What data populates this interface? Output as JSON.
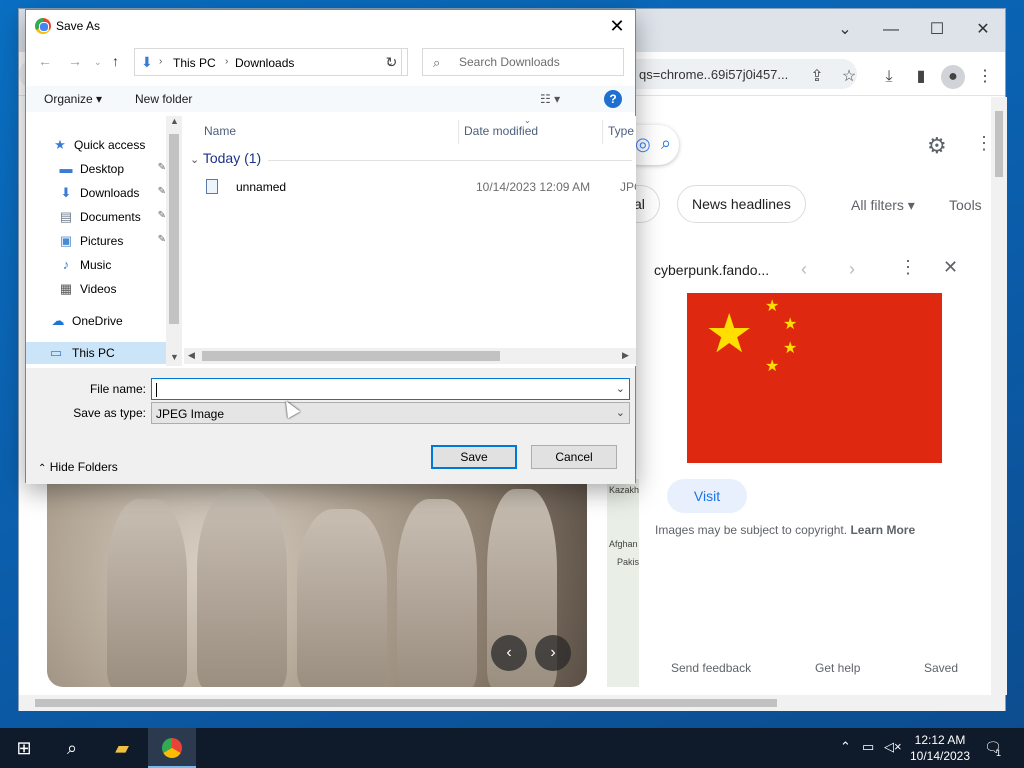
{
  "browser": {
    "url_fragment": "qs=chrome..69i57j0i457...",
    "chips": [
      "ital",
      "News headlines"
    ],
    "all_filters": "All filters",
    "tools": "Tools",
    "panel_source": "cyberpunk.fando...",
    "visit": "Visit",
    "copyright": "Images may be subject to copyright.",
    "learn_more": "Learn More",
    "footer": [
      "Send feedback",
      "Get help",
      "Saved"
    ],
    "map_labels": [
      "Kazakh",
      "Afghan",
      "Pakis"
    ]
  },
  "dialog": {
    "title": "Save As",
    "breadcrumb": [
      "This PC",
      "Downloads"
    ],
    "search_placeholder": "Search Downloads",
    "organize": "Organize",
    "new_folder": "New folder",
    "help": "?",
    "tree": [
      {
        "label": "Quick access",
        "icon": "star-icon"
      },
      {
        "label": "Desktop",
        "icon": "desktop-icon",
        "pinned": true
      },
      {
        "label": "Downloads",
        "icon": "download-icon",
        "pinned": true
      },
      {
        "label": "Documents",
        "icon": "documents-icon",
        "pinned": true
      },
      {
        "label": "Pictures",
        "icon": "pictures-icon",
        "pinned": true
      },
      {
        "label": "Music",
        "icon": "music-icon"
      },
      {
        "label": "Videos",
        "icon": "videos-icon"
      },
      {
        "label": "OneDrive",
        "icon": "cloud-icon"
      },
      {
        "label": "This PC",
        "icon": "computer-icon",
        "selected": true
      }
    ],
    "columns": [
      "Name",
      "Date modified",
      "Type"
    ],
    "group": "Today (1)",
    "files": [
      {
        "name": "unnamed",
        "date": "10/14/2023 12:09 AM",
        "type": "JPG F"
      }
    ],
    "file_name_label": "File name:",
    "file_name_value": "",
    "save_type_label": "Save as type:",
    "save_type_value": "JPEG Image",
    "hide_folders": "Hide Folders",
    "save": "Save",
    "cancel": "Cancel"
  },
  "taskbar": {
    "time": "12:12 AM",
    "date": "10/14/2023",
    "notification_count": "1"
  }
}
